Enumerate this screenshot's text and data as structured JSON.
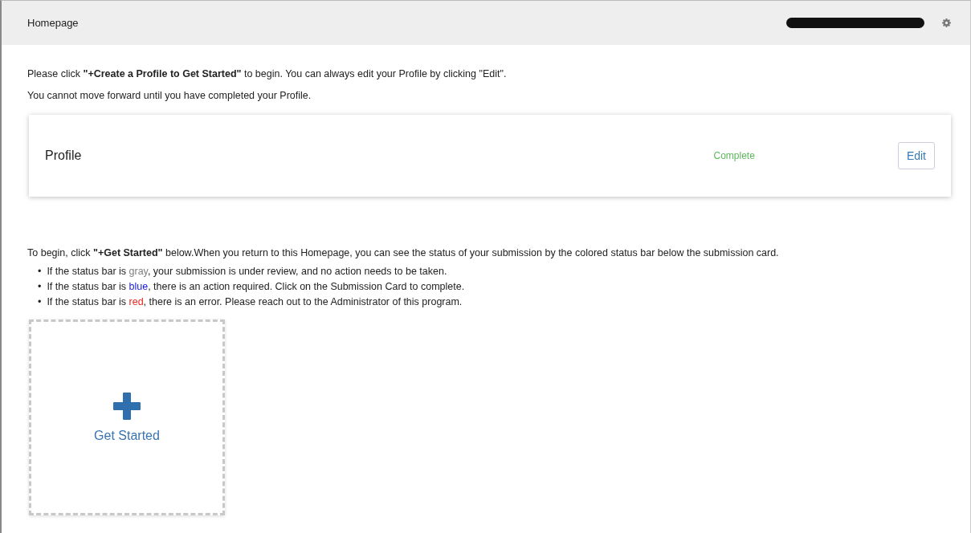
{
  "header": {
    "title": "Homepage"
  },
  "intro": [
    "Please click **\"+Create a Profile to Get Started\"** to begin. You can always edit your Profile by clicking \"Edit\".",
    "You cannot move forward until you have completed your Profile."
  ],
  "profile_card": {
    "title": "Profile",
    "status": "Complete",
    "button": "Edit"
  },
  "instructions": "To begin, click **\"+Get Started\"** below.When you return to this Homepage, you can see the status of your submission by the colored status bar below the submission card.",
  "bullets": [
    {
      "marker": "•",
      "before": "If the status bar is ",
      "word": "gray",
      "after": ", your submission is under review, and no action needs to be taken.",
      "color": "#808080"
    },
    {
      "marker": "•",
      "before": "If the status bar is ",
      "word": "blue",
      "after": ", there is an action required. Click on the Submission Card to complete.",
      "color": "#1a1adc"
    },
    {
      "marker": "•",
      "before": "If the status bar is ",
      "word": "red",
      "after": ", there is an error. Please reach out to the Administrator of this program.",
      "color": "#e8231e"
    }
  ],
  "new_card": {
    "label": "Get Started"
  }
}
